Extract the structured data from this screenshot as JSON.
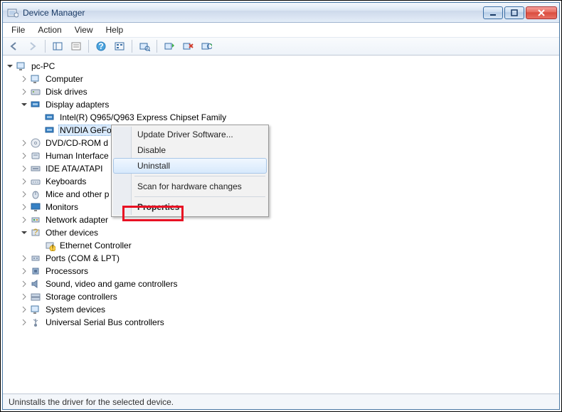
{
  "window": {
    "title": "Device Manager"
  },
  "menu": {
    "file": "File",
    "action": "Action",
    "view": "View",
    "help": "Help"
  },
  "tree": {
    "root": "pc-PC",
    "computer": "Computer",
    "disk_drives": "Disk drives",
    "display_adapters": "Display adapters",
    "da_intel": "Intel(R)  Q965/Q963 Express Chipset Family",
    "da_nvidia": "NVIDIA GeFo",
    "dvd": "DVD/CD-ROM d",
    "hid": "Human Interface",
    "ide": "IDE ATA/ATAPI",
    "keyboards": "Keyboards",
    "mice": "Mice and other p",
    "monitors": "Monitors",
    "network": "Network adapter",
    "other": "Other devices",
    "other_eth": "Ethernet Controller",
    "ports": "Ports (COM & LPT)",
    "processors": "Processors",
    "sound": "Sound, video and game controllers",
    "storage": "Storage controllers",
    "system": "System devices",
    "usb": "Universal Serial Bus controllers"
  },
  "context": {
    "update": "Update Driver Software...",
    "disable": "Disable",
    "uninstall": "Uninstall",
    "scan": "Scan for hardware changes",
    "properties": "Properties"
  },
  "status": {
    "text": "Uninstalls the driver for the selected device."
  }
}
